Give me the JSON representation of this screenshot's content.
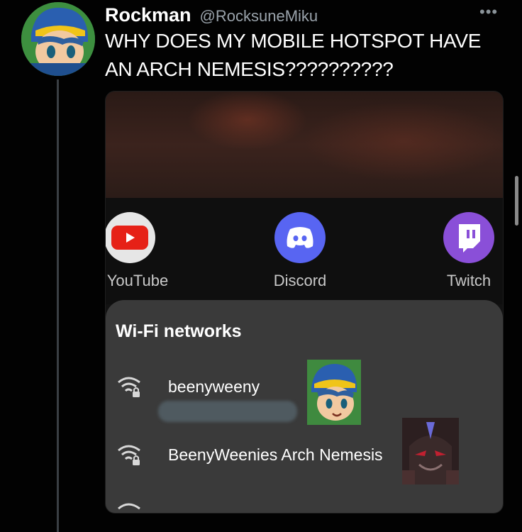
{
  "tweet": {
    "display_name": "Rockman",
    "handle": "@RocksuneMiku",
    "more_icon": "more-horizontal-icon",
    "text_line1": "WHY DOES MY MOBILE HOTSPOT HAVE",
    "text_line2": "AN ARCH NEMESIS??????????"
  },
  "screenshot": {
    "apps": [
      {
        "label": "YouTube",
        "visible_label": "ouTube",
        "icon": "youtube-icon",
        "color": "#e62117"
      },
      {
        "label": "Discord",
        "icon": "discord-icon",
        "color": "#5865f2"
      },
      {
        "label": "Twitch",
        "icon": "twitch-icon",
        "color": "#8a4fd8"
      }
    ],
    "wifi_section_title": "Wi-Fi networks",
    "networks": [
      {
        "name": "beenyweeny",
        "icon": "wifi-lock-icon"
      },
      {
        "name": "BeenyWeenies Arch Nemesis",
        "icon": "wifi-lock-icon"
      }
    ],
    "panel_color": "#3a3a3a"
  },
  "colors": {
    "background": "#000000",
    "text_primary": "#ffffff",
    "text_secondary": "#9aa3ab"
  }
}
